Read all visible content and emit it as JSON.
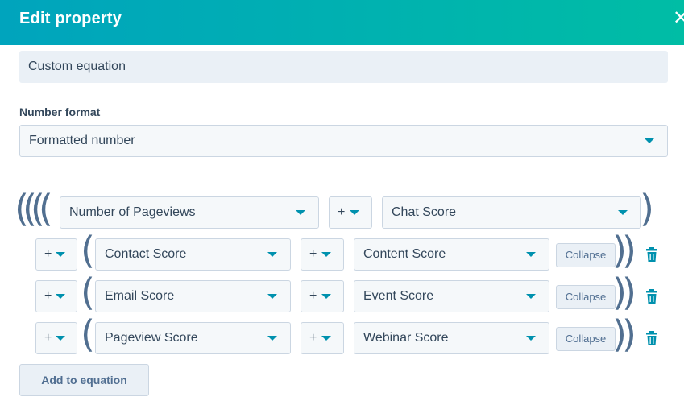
{
  "header": {
    "title": "Edit property",
    "close_icon": "close-icon"
  },
  "equation_type": {
    "value": "Custom equation"
  },
  "number_format": {
    "label": "Number format",
    "value": "Formatted number"
  },
  "main_row": {
    "left_paren": "((((",
    "left_property": "Number of Pageviews",
    "operator": "+",
    "right_property": "Chat Score",
    "right_paren": ")"
  },
  "nested_rows": [
    {
      "operator": "+",
      "left_property": "Contact Score",
      "inner_operator": "+",
      "right_property": "Content Score",
      "collapse_label": "Collapse"
    },
    {
      "operator": "+",
      "left_property": "Email Score",
      "inner_operator": "+",
      "right_property": "Event Score",
      "collapse_label": "Collapse"
    },
    {
      "operator": "+",
      "left_property": "Pageview Score",
      "inner_operator": "+",
      "right_property": "Webinar Score",
      "collapse_label": "Collapse"
    }
  ],
  "paren_open": "(",
  "paren_close_double": "))",
  "actions": {
    "add_label": "Add to equation"
  },
  "colors": {
    "accent": "#0091ae",
    "header_start": "#00a4bd",
    "header_end": "#00bda5",
    "text": "#33475b"
  }
}
